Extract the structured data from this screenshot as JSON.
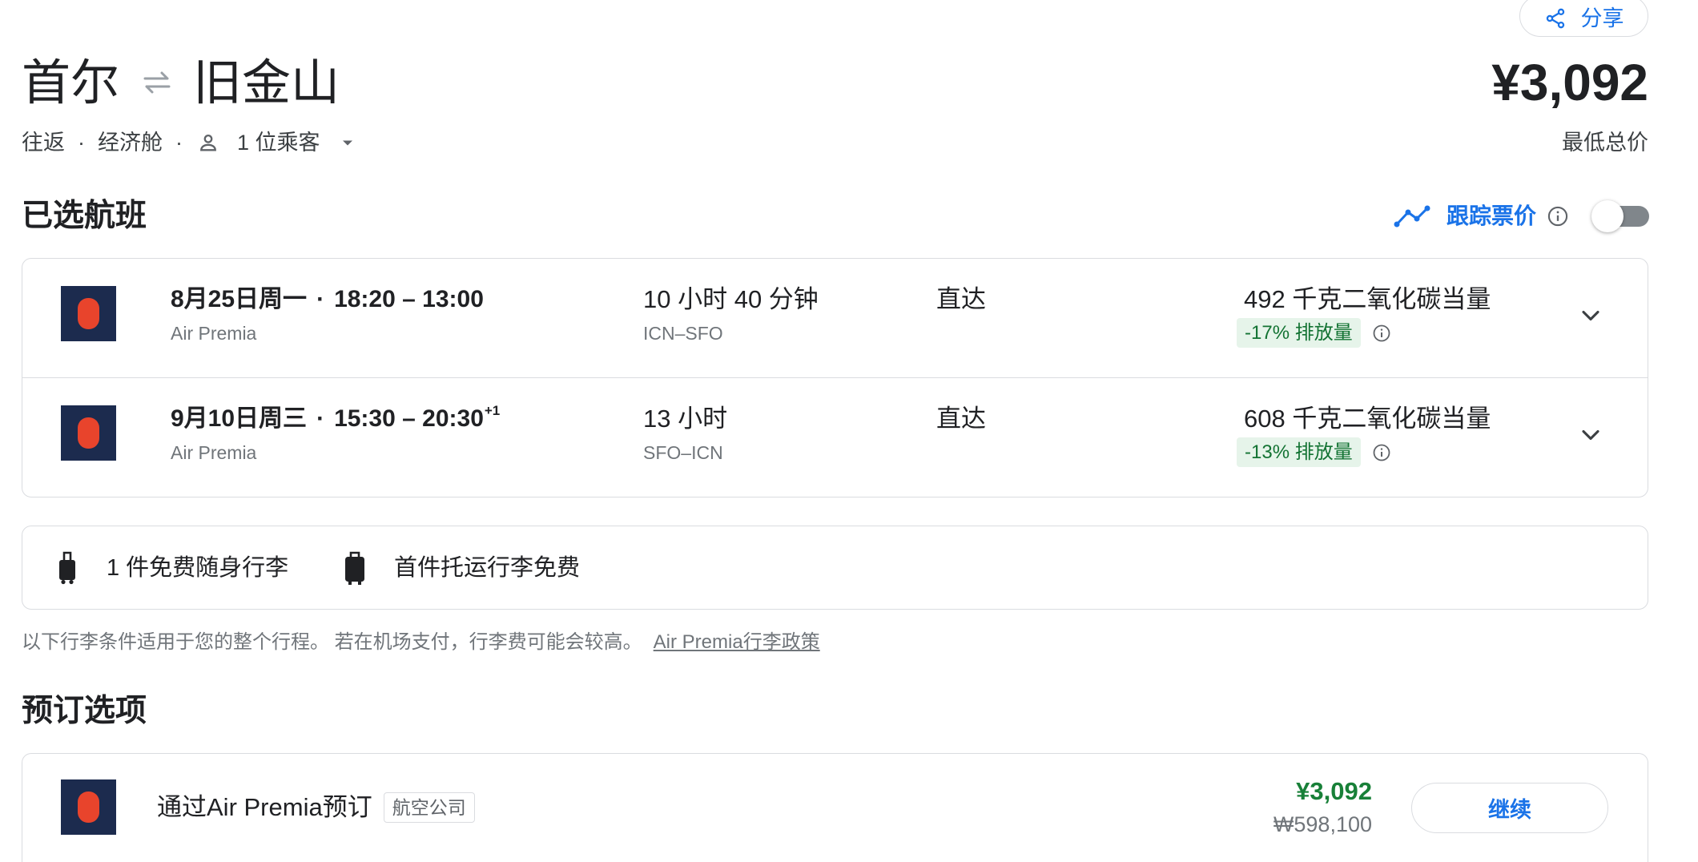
{
  "header": {
    "share_label": "分享",
    "origin": "首尔",
    "destination": "旧金山",
    "price": "¥3,092",
    "price_caption": "最低总价",
    "trip_type": "往返",
    "cabin": "经济舱",
    "passengers": "1 位乘客",
    "separator": "·"
  },
  "selected": {
    "heading": "已选航班",
    "track_label": "跟踪票价",
    "track_enabled": false
  },
  "flights": [
    {
      "date": "8月25日周一",
      "times": "18:20 – 13:00",
      "plus_days": "",
      "airline": "Air Premia",
      "duration": "10 小时 40 分钟",
      "route": "ICN–SFO",
      "stops": "直达",
      "emissions": "492 千克二氧化碳当量",
      "emissions_delta": "-17% 排放量"
    },
    {
      "date": "9月10日周三",
      "times": "15:30 – 20:30",
      "plus_days": "+1",
      "airline": "Air Premia",
      "duration": "13 小时",
      "route": "SFO–ICN",
      "stops": "直达",
      "emissions": "608 千克二氧化碳当量",
      "emissions_delta": "-13% 排放量"
    }
  ],
  "baggage": {
    "carry_on": "1 件免费随身行李",
    "checked": "首件托运行李免费",
    "note": "以下行李条件适用于您的整个行程。 若在机场支付，行李费可能会较高。",
    "policy_link": "Air Premia行李政策"
  },
  "booking": {
    "heading": "预订选项",
    "provider": "通过Air Premia预订",
    "provider_type": "航空公司",
    "price": "¥3,092",
    "price_local": "₩598,100",
    "continue_label": "继续"
  },
  "icons": {
    "share": "share-icon",
    "swap": "swap-arrows-icon",
    "passenger": "person-icon",
    "dropdown": "caret-down-icon",
    "track": "price-trend-icon",
    "info": "info-icon",
    "expand": "chevron-down-icon",
    "carry_on": "carry-on-bag-icon",
    "checked": "checked-bag-icon"
  },
  "colors": {
    "accent_blue": "#1a73e8",
    "price_green": "#188038",
    "badge_bg": "#e6f4ea",
    "badge_text": "#137333",
    "logo_navy": "#1c2b4e",
    "logo_red": "#e8442c",
    "border": "#dadce0",
    "muted_text": "#70757a"
  }
}
